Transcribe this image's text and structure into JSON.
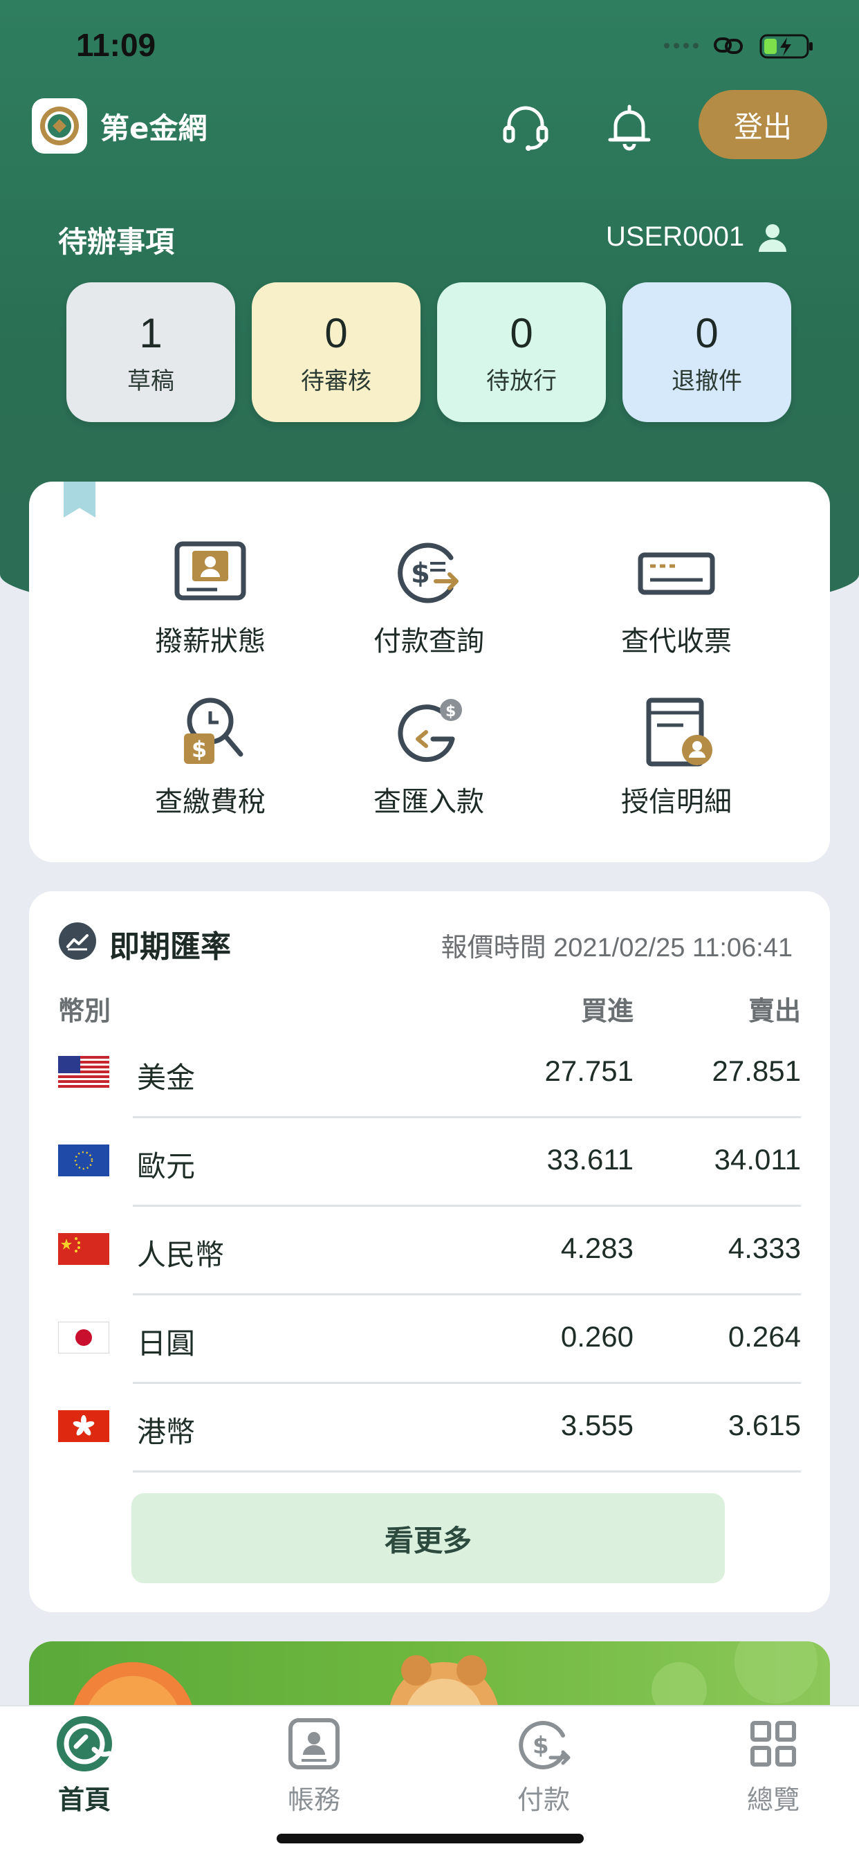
{
  "status": {
    "time": "11:09"
  },
  "header": {
    "app_name": "第e金網",
    "logout_label": "登出"
  },
  "todo": {
    "title": "待辦事項",
    "user_id": "USER0001",
    "items": [
      {
        "count": "1",
        "label": "草稿",
        "color": "#e6e9ec"
      },
      {
        "count": "0",
        "label": "待審核",
        "color": "#f8f0c8"
      },
      {
        "count": "0",
        "label": "待放行",
        "color": "#d6f7e9"
      },
      {
        "count": "0",
        "label": "退撤件",
        "color": "#d6e9fb"
      }
    ]
  },
  "menu": {
    "items": [
      {
        "label": "撥薪狀態",
        "icon": "payroll-icon"
      },
      {
        "label": "付款查詢",
        "icon": "payment-query-icon"
      },
      {
        "label": "查代收票",
        "icon": "collection-check-icon"
      },
      {
        "label": "查繳費稅",
        "icon": "tax-payment-icon"
      },
      {
        "label": "查匯入款",
        "icon": "inward-remittance-icon"
      },
      {
        "label": "授信明細",
        "icon": "credit-detail-icon"
      }
    ]
  },
  "rates": {
    "title": "即期匯率",
    "quote_time": "報價時間 2021/02/25 11:06:41",
    "columns": {
      "currency": "幣別",
      "buy": "買進",
      "sell": "賣出"
    },
    "rows": [
      {
        "currency": "美金",
        "flag": "us-flag",
        "buy": "27.751",
        "sell": "27.851"
      },
      {
        "currency": "歐元",
        "flag": "eu-flag",
        "buy": "33.611",
        "sell": "34.011"
      },
      {
        "currency": "人民幣",
        "flag": "cn-flag",
        "buy": "4.283",
        "sell": "4.333"
      },
      {
        "currency": "日圓",
        "flag": "jp-flag",
        "buy": "0.260",
        "sell": "0.264"
      },
      {
        "currency": "港幣",
        "flag": "hk-flag",
        "buy": "3.555",
        "sell": "3.615"
      }
    ],
    "more_label": "看更多"
  },
  "tabbar": {
    "items": [
      {
        "label": "首頁",
        "icon": "home-icon",
        "active": true
      },
      {
        "label": "帳務",
        "icon": "account-icon",
        "active": false
      },
      {
        "label": "付款",
        "icon": "payment-icon",
        "active": false
      },
      {
        "label": "總覽",
        "icon": "overview-icon",
        "active": false
      }
    ]
  },
  "colors": {
    "primary": "#2f7e5f",
    "accent_gold": "#b48c45",
    "more_button": "#dcf0de"
  }
}
